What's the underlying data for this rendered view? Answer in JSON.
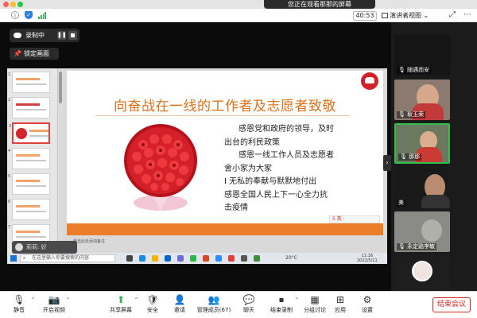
{
  "window": {
    "share_banner": "您正在观看那那的屏幕"
  },
  "topbar": {
    "timer": "40:53",
    "view_label": "演讲者视图"
  },
  "recording": {
    "label": "录制中"
  },
  "lock": {
    "label": "锁定画面"
  },
  "slide": {
    "title": "向奋战在一线的工作者及志愿者致敬",
    "lines": [
      "感恩党和政府的领导，及时",
      "出台的利民政策",
      "感恩一线工作人员及志愿者",
      "舍小家为大家",
      "I 无私的奉献与默默地付出",
      "感恩全国人民上下一心全力抗",
      "击疫情"
    ],
    "toolbar_text": "S 英 ·"
  },
  "thumbnails": [
    "1",
    "2",
    "3",
    "4",
    "5",
    "6",
    "7"
  ],
  "ppt_status": "单击此处添加备注",
  "taskbar": {
    "search_placeholder": "在这里输入你要搜索的内容",
    "weather": "20°C",
    "time": "11:16",
    "date": "2022/5/11"
  },
  "chat_overlay": {
    "text": "莉莉: 好"
  },
  "gallery": {
    "tiles": [
      {
        "name": "随遇而安"
      },
      {
        "name": "耿玉荣"
      },
      {
        "name": "那那"
      },
      {
        "name": "美"
      },
      {
        "name": "永定路李敏"
      },
      {
        "name": ""
      }
    ]
  },
  "bottombar": {
    "mute": "静音",
    "video": "开启视频",
    "share": "共享屏幕",
    "security": "安全",
    "invite": "邀请",
    "participants": "管理成员(67)",
    "chat": "聊天",
    "record": "结束录制",
    "breakout": "分组讨论",
    "apps": "应用",
    "settings": "设置",
    "end": "结束会议"
  }
}
